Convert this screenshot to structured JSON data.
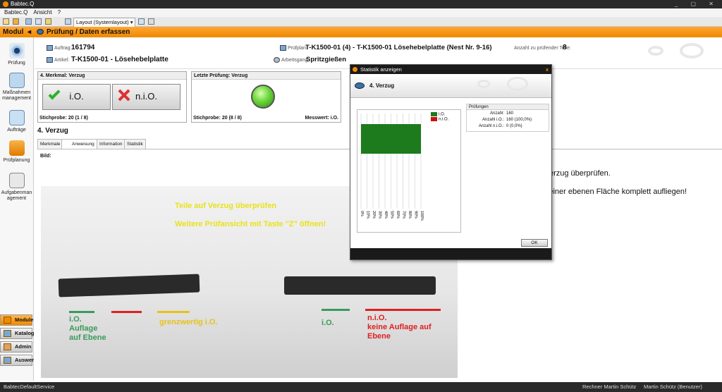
{
  "app": {
    "title": "Babtec.Q"
  },
  "menu": [
    "Babtec.Q",
    "Ansicht",
    "?"
  ],
  "toolbar": {
    "layout_label": "Layout (Systemlayout)"
  },
  "orangebar": {
    "modul": "Modul",
    "page_title": "Prüfung / Daten erfassen"
  },
  "sidebar": {
    "items": [
      {
        "label": "Prüfung",
        "icon": "eye-icon"
      },
      {
        "label": "Maßnahmenmanagement",
        "icon": "measures-icon"
      },
      {
        "label": "Aufträge",
        "icon": "orders-icon"
      },
      {
        "label": "Prüfplanung",
        "icon": "planning-icon"
      },
      {
        "label": "Aufgabenmanagement",
        "icon": "tasks-icon"
      }
    ],
    "buttons": [
      "Module",
      "Katalog",
      "Admin",
      "Auswer"
    ]
  },
  "header": {
    "auftrag_label": "Auftrag:",
    "auftrag_value": "161794",
    "artikel_label": "Artikel:",
    "artikel_value": "T-K1500-01 - Lösehebelplatte",
    "pruefplan_label": "Prüfplan:",
    "pruefplan_value": "T-K1500-01 (4) - T-K1500-01 Lösehebelplatte (Nest Nr. 9-16)",
    "arbeitsgang_label": "Arbeitsgang:",
    "arbeitsgang_value": "Spritzgießen",
    "anzahl_label": "Anzahl zu prüfender Teile:",
    "anzahl_value": "8"
  },
  "merkmal": {
    "title": "4. Merkmal: Verzug",
    "io_label": "i.O.",
    "nio_label": "n.i.O.",
    "stichprobe": "Stichprobe: 20 (1 / 8)"
  },
  "letzte": {
    "title": "Letzte Prüfung: Verzug",
    "stichprobe": "Stichprobe: 20 (8 / 8)",
    "messwert": "Messwert: i.O."
  },
  "section": {
    "title": "4. Verzug",
    "tabs": [
      "Merkmale",
      "Anweisung",
      "Information",
      "Statistik"
    ],
    "bild_label": "Bild:"
  },
  "photo": {
    "line1": "Teile auf Verzug überprüfen",
    "line2": "Weitere Prüfansicht mit Taste \"Z\" öffnen!",
    "left_io": "i.O.",
    "left_auflage": "Auflage",
    "left_ebene": "auf Ebene",
    "grenz": "grenzwertig i.O.",
    "right_io": "i.O.",
    "right_nio": "n.i.O.",
    "right_keine": "keine Auflage auf",
    "right_ebene": "Ebene",
    "colors": {
      "green": "#3a9a5a",
      "red": "#e02020",
      "yellow": "#e8c21a"
    }
  },
  "instructions": {
    "line1": "uf Verzug überprüfen.",
    "line2": "auf einer ebenen Fläche komplett aufliegen!"
  },
  "dialog": {
    "title": "Statistik anzeigen",
    "close": "x",
    "header": "4. Verzug",
    "ok": "OK",
    "stats": {
      "header": "Prüfungen",
      "anzahl_label": "Anzahl:",
      "anzahl_value": "160",
      "io_label": "Anzahl i.O.:",
      "io_value": "160  (100,0%)",
      "nio_label": "Anzahl n.i.O.:",
      "nio_value": "0  (0,0%)"
    }
  },
  "chart_data": {
    "type": "bar",
    "orientation": "horizontal",
    "categories": [
      "i.O.",
      "n.i.O."
    ],
    "series": [
      {
        "name": "i.O.",
        "values": [
          100,
          0
        ],
        "color": "#1d7a1d"
      },
      {
        "name": "n.i.O.",
        "values": [
          0,
          0
        ],
        "color": "#cc1111"
      }
    ],
    "x_ticks": [
      "0%",
      "10%",
      "20%",
      "30%",
      "40%",
      "50%",
      "60%",
      "70%",
      "80%",
      "90%",
      "100%"
    ],
    "xlim": [
      0,
      100
    ],
    "grid": true,
    "legend": "right"
  },
  "status": {
    "service": "BabtecDefaultService",
    "rechner": "Rechner Martin Schütz",
    "user": "Martin Schütz (Benutzer)"
  }
}
